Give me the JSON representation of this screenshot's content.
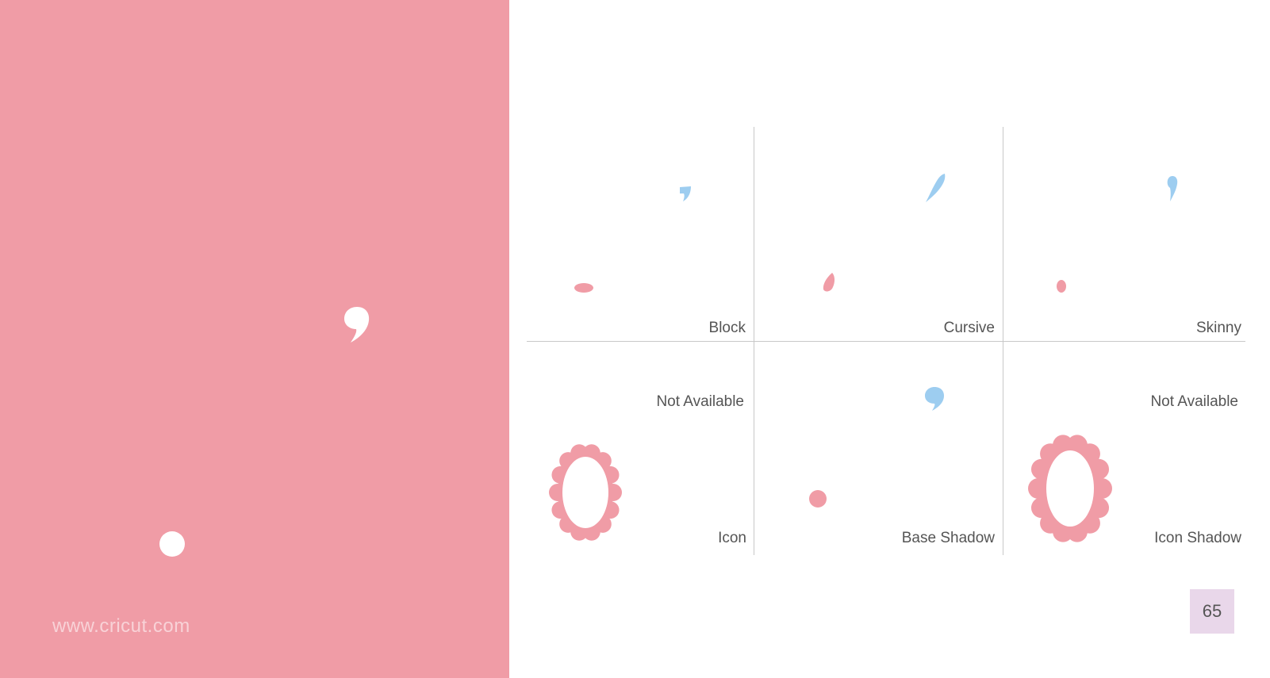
{
  "colors": {
    "left_bg": "#f09ca6",
    "pink": "#f09ca6",
    "blue": "#9dcdf0",
    "white": "#ffffff",
    "page_badge": "#e9d7ea",
    "text": "#555555"
  },
  "left_panel": {
    "website": "www.cricut.com"
  },
  "grid": {
    "cells": [
      {
        "label": "Block"
      },
      {
        "label": "Cursive"
      },
      {
        "label": "Skinny"
      },
      {
        "top_label": "Not Available",
        "label": "Icon"
      },
      {
        "label": "Base Shadow"
      },
      {
        "top_label": "Not Available",
        "label": "Icon Shadow"
      }
    ]
  },
  "page_number": "65",
  "icons": [
    "comma-glyph-icon",
    "dot-glyph-icon",
    "scalloped-oval-frame-icon"
  ]
}
